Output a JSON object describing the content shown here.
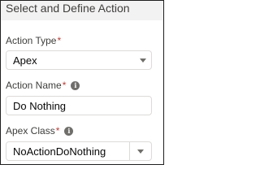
{
  "header": {
    "title": "Select and Define Action"
  },
  "fields": [
    {
      "label": "Action Type",
      "required": "*",
      "value": "Apex",
      "control": "select"
    },
    {
      "label": "Action Name",
      "required": "*",
      "value": "Do Nothing",
      "control": "text",
      "has_info": true
    },
    {
      "label": "Apex Class",
      "required": "*",
      "value": "NoActionDoNothing",
      "control": "combobox",
      "has_info": true
    }
  ],
  "icons": {
    "info": "info-icon",
    "dropdown": "chevron-down-icon"
  },
  "colors": {
    "header_bg": "#f3f2f2",
    "required": "#c23934",
    "border": "#dddbda",
    "icon": "#706e6b"
  }
}
